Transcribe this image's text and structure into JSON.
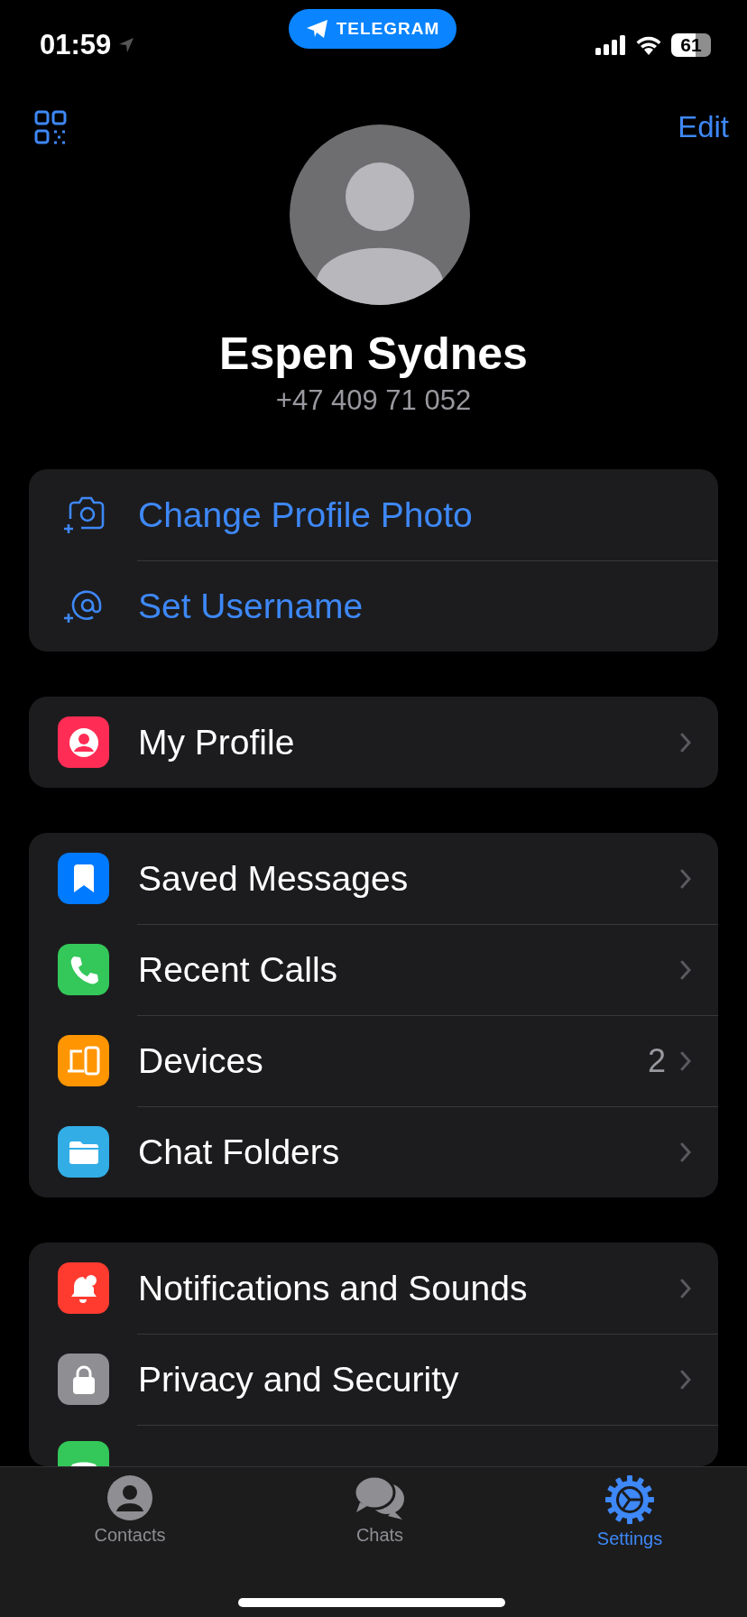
{
  "status_bar": {
    "time": "01:59",
    "app_pill": "TELEGRAM",
    "battery": "61"
  },
  "header": {
    "edit": "Edit"
  },
  "profile": {
    "name": "Espen Sydnes",
    "phone": "+47 409 71 052"
  },
  "sections": [
    {
      "items": [
        {
          "kind": "camera",
          "label": "Change Profile Photo"
        },
        {
          "kind": "mention",
          "label": "Set Username"
        }
      ]
    },
    {
      "items": [
        {
          "kind": "profile",
          "label": "My Profile",
          "color": "#ff2d55"
        }
      ]
    },
    {
      "items": [
        {
          "kind": "bookmark",
          "label": "Saved Messages",
          "color": "#007aff"
        },
        {
          "kind": "phone",
          "label": "Recent Calls",
          "color": "#34c759"
        },
        {
          "kind": "devices",
          "label": "Devices",
          "color": "#ff9500",
          "count": "2"
        },
        {
          "kind": "folder",
          "label": "Chat Folders",
          "color": "#32ade6"
        }
      ]
    },
    {
      "items": [
        {
          "kind": "bell",
          "label": "Notifications and Sounds",
          "color": "#ff3b30"
        },
        {
          "kind": "lock",
          "label": "Privacy and Security",
          "color": "#8e8e93"
        },
        {
          "kind": "data",
          "color": "#34c759"
        }
      ]
    }
  ],
  "tabs": [
    {
      "kind": "contacts",
      "label": "Contacts",
      "selected": false
    },
    {
      "kind": "chats",
      "label": "Chats",
      "selected": false
    },
    {
      "kind": "settings",
      "label": "Settings",
      "selected": true
    }
  ]
}
